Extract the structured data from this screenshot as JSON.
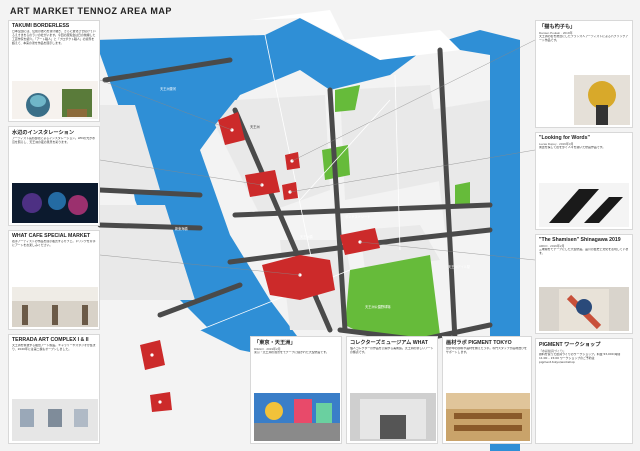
{
  "page": {
    "title": "ART MARKET TENNOZ AREA MAP"
  },
  "colors": {
    "water": "#2f8fd6",
    "road": "#4a4a4a",
    "park": "#66bb3a",
    "venue": "#cc2a2a",
    "block": "#e9e9e9"
  },
  "map_labels": {
    "canal_name": "天王洲運河",
    "island_name": "天王洲",
    "bridge_1": "天王洲橋",
    "bridge_2": "新東海橋",
    "street": "ボンドストリート",
    "park": "天王洲公園野球場",
    "station": "天王洲アイル駅"
  },
  "left_cards": [
    {
      "title": "TAKUMI BORDERLESS",
      "body": "日本全国には、伝統の技巧を受け継ぎ、さらに進化させ続けているえきまをるのラジの社がいます。今回の展覧会は日の前縁した工芸作家を紹介。「アート職人」と「プロダクト職人」の境界を超えて、本来の姿を作品を展示します。",
      "sub": ""
    },
    {
      "title": "水辺のインスタレーション",
      "body": "アーティスト長谷部太によるインスタレーション。LEDの光が水辺を照らし、天王洲の夜の風景を彩ります。",
      "sub": ""
    },
    {
      "title": "WHAT CAFE SPECIAL MARKET",
      "body": "若手アーティストの作品を展示販売するカフェ。ドリンクを片手にアートをお楽しみください。",
      "sub": ""
    },
    {
      "title": "TERRADA ART COMPLEX I & II",
      "body": "天王洲を象徴する複合アート施設。ギャラリーやスタジオが集まり、2020年には第二棟もオープンしました。",
      "sub": ""
    }
  ],
  "right_cards": [
    {
      "title": "「猫も杓子も」",
      "sub": "Damien Poulain · 2019年",
      "body": "天王洲の街を舞台にしたフランス人アーティストによるパブリックアート作品です。"
    },
    {
      "title": "\"Looking for Words\"",
      "sub": "Lucas Dupuy · 2019年3月",
      "body": "言葉を探して街を歩く人々を描いた壁画作品です。"
    },
    {
      "title": "\"The Shamisen\" Shinagawa 2019",
      "sub": "ARKO · 2019年2月",
      "body": "三味線をモチーフにした大型壁画。品川の歴史と文化を表現しています。"
    },
    {
      "title": "PIGMENT ワークショップ",
      "sub": "「水彩絵具づくり」",
      "body": "顔料を使った絵具づくりのワークショップ。料金 ¥3,000 時間 11:00 – 15:00 ワークショップのご予約は pigment.tokyo/workshop"
    }
  ],
  "bottom_cards": [
    {
      "title": "「東京・天王洲」",
      "sub": "DIEGO · 2019年2月",
      "body": "東京・天王洲の風景をモチーフに描かれた大型壁画です。"
    },
    {
      "title": "コレクターズミュージアム WHAT",
      "sub": "",
      "body": "個人コレクターの作品を公開する美術館。天王洲の新しいアートの拠点です。"
    },
    {
      "title": "画材ラボ PIGMENT TOKYO",
      "sub": "",
      "body": "世界中の顔料や画材を揃えたラボ。専門スタッフが画材選びをサポートします。"
    }
  ]
}
